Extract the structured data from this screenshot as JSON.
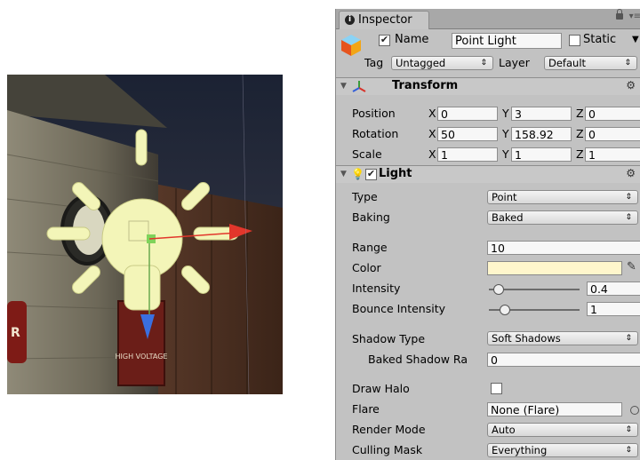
{
  "scene": {
    "background": "#2b2d38",
    "light_color": "#f3f5b8",
    "sign_text": "HIGH VOLTAGE",
    "sign_partial": "R"
  },
  "inspector": {
    "tab_label": "Inspector",
    "object": {
      "enabled": true,
      "name_label": "Name",
      "name_value": "Point Light",
      "static_label": "Static",
      "static_checked": false,
      "tag_label": "Tag",
      "tag_value": "Untagged",
      "layer_label": "Layer",
      "layer_value": "Default"
    },
    "transform": {
      "title": "Transform",
      "rows": [
        {
          "label": "Position",
          "x": "0",
          "y": "3",
          "z": "0"
        },
        {
          "label": "Rotation",
          "x": "50",
          "y": "158.92",
          "z": "0"
        },
        {
          "label": "Scale",
          "x": "1",
          "y": "1",
          "z": "1"
        }
      ],
      "axis_x": "X",
      "axis_y": "Y",
      "axis_z": "Z"
    },
    "light": {
      "title": "Light",
      "enabled": true,
      "type_label": "Type",
      "type_value": "Point",
      "baking_label": "Baking",
      "baking_value": "Baked",
      "range_label": "Range",
      "range_value": "10",
      "color_label": "Color",
      "color_value": "#fff6cc",
      "intensity_label": "Intensity",
      "intensity_value": "0.4",
      "intensity_fraction": 0.05,
      "bounce_label": "Bounce Intensity",
      "bounce_value": "1",
      "bounce_fraction": 0.12,
      "shadow_type_label": "Shadow Type",
      "shadow_type_value": "Soft Shadows",
      "baked_shadow_label": "Baked Shadow Ra",
      "baked_shadow_value": "0",
      "draw_halo_label": "Draw Halo",
      "draw_halo_checked": false,
      "flare_label": "Flare",
      "flare_value": "None (Flare)",
      "render_mode_label": "Render Mode",
      "render_mode_value": "Auto",
      "culling_mask_label": "Culling Mask",
      "culling_mask_value": "Everything"
    }
  }
}
